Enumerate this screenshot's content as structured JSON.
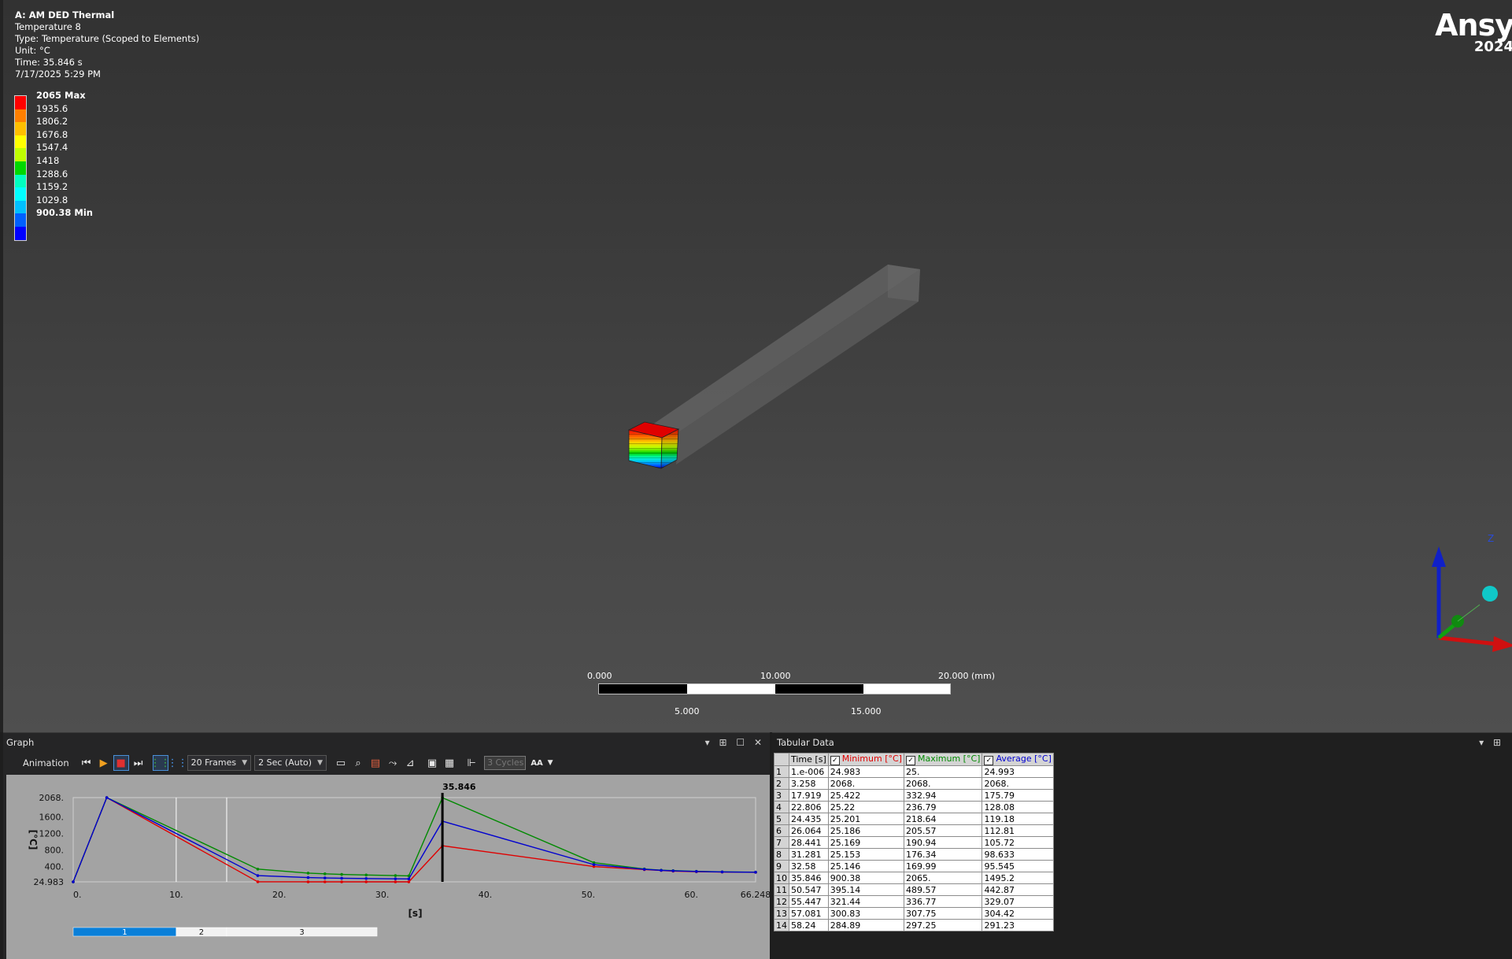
{
  "result": {
    "system": "A: AM DED Thermal",
    "name": "Temperature 8",
    "type": "Type: Temperature (Scoped to Elements)",
    "unit": "Unit: °C",
    "time": "Time: 35.846 s",
    "date": "7/17/2025 5:29 PM"
  },
  "legend": {
    "labels": [
      "2065 Max",
      "1935.6",
      "1806.2",
      "1676.8",
      "1547.4",
      "1418",
      "1288.6",
      "1159.2",
      "1029.8",
      "900.38 Min"
    ],
    "colors": [
      "#ff0000",
      "#ff7f00",
      "#ffbf00",
      "#ffff00",
      "#bfff00",
      "#00d800",
      "#00ffbf",
      "#00ffff",
      "#00bfff",
      "#0060ff",
      "#0000ff"
    ]
  },
  "brand": {
    "name": "Ansy",
    "year": "2024"
  },
  "scale_bar": {
    "top_labels": [
      "0.000",
      "10.000",
      "20.000 (mm)"
    ],
    "bottom_labels": [
      "5.000",
      "15.000"
    ]
  },
  "triad": {
    "z_label": "Z"
  },
  "graph_panel": {
    "title": "Graph",
    "tools": {
      "dropdown": "▾",
      "pin": "⊞",
      "maximize": "☐",
      "close": "✕"
    },
    "animation": {
      "label": "Animation",
      "frames": "20 Frames",
      "duration": "2 Sec (Auto)",
      "cycles": "3 Cycles",
      "aa_label": "AA"
    }
  },
  "chart_data": {
    "type": "line",
    "x": [
      1e-06,
      3.258,
      17.919,
      22.806,
      24.435,
      26.064,
      28.441,
      31.281,
      32.58,
      35.846,
      50.547,
      55.447,
      57.081,
      58.24,
      60.5,
      63.0,
      66.248
    ],
    "series": [
      {
        "name": "Minimum [°C]",
        "color": "#e00000",
        "values": [
          24.983,
          2068,
          25.422,
          25.22,
          25.201,
          25.186,
          25.169,
          25.153,
          25.146,
          900.38,
          395.14,
          321.44,
          300.83,
          284.89,
          270,
          262,
          255
        ]
      },
      {
        "name": "Maximum [°C]",
        "color": "#008a00",
        "values": [
          25,
          2068,
          332.94,
          236.79,
          218.64,
          205.57,
          190.94,
          176.34,
          169.99,
          2065,
          489.57,
          336.77,
          307.75,
          297.25,
          280,
          268,
          260
        ]
      },
      {
        "name": "Average [°C]",
        "color": "#0000d0",
        "values": [
          24.993,
          2068,
          175.79,
          128.08,
          119.18,
          112.81,
          105.72,
          98.633,
          95.545,
          1495.2,
          442.87,
          329.07,
          304.42,
          291.23,
          276,
          265,
          258
        ]
      }
    ],
    "x_ticks": [
      "0.",
      "10.",
      "20.",
      "30.",
      "40.",
      "50.",
      "60.",
      "66.248"
    ],
    "x_tick_values": [
      0,
      10,
      20,
      30,
      40,
      50,
      60,
      66.248
    ],
    "y_ticks": [
      "24.983",
      "400.",
      "800.",
      "1200.",
      "1600.",
      "2068."
    ],
    "y_tick_values": [
      24.983,
      400,
      800,
      1200,
      1600,
      2068
    ],
    "xlabel": "[s]",
    "ylabel": "[°C]",
    "xlim": [
      0,
      66.248
    ],
    "ylim": [
      24.983,
      2068
    ],
    "current_time": 35.846,
    "current_time_label": "35.846",
    "step_markers": [
      10,
      14.9
    ],
    "steps": [
      {
        "label": "1",
        "start": 0,
        "end": 10
      },
      {
        "label": "2",
        "start": 10,
        "end": 14.9
      },
      {
        "label": "3",
        "start": 14.9,
        "end": 29.5
      }
    ]
  },
  "tabular_panel": {
    "title": "Tabular Data",
    "tools": {
      "dropdown": "▾",
      "pin": "⊞"
    },
    "columns": [
      "Time [s]",
      "Minimum [°C]",
      "Maximum [°C]",
      "Average [°C]"
    ],
    "column_colors": [
      "#000000",
      "#e00000",
      "#008a00",
      "#0000d0"
    ],
    "rows": [
      [
        "1",
        "1.e-006",
        "24.983",
        "25.",
        "24.993"
      ],
      [
        "2",
        "3.258",
        "2068.",
        "2068.",
        "2068."
      ],
      [
        "3",
        "17.919",
        "25.422",
        "332.94",
        "175.79"
      ],
      [
        "4",
        "22.806",
        "25.22",
        "236.79",
        "128.08"
      ],
      [
        "5",
        "24.435",
        "25.201",
        "218.64",
        "119.18"
      ],
      [
        "6",
        "26.064",
        "25.186",
        "205.57",
        "112.81"
      ],
      [
        "7",
        "28.441",
        "25.169",
        "190.94",
        "105.72"
      ],
      [
        "8",
        "31.281",
        "25.153",
        "176.34",
        "98.633"
      ],
      [
        "9",
        "32.58",
        "25.146",
        "169.99",
        "95.545"
      ],
      [
        "10",
        "35.846",
        "900.38",
        "2065.",
        "1495.2"
      ],
      [
        "11",
        "50.547",
        "395.14",
        "489.57",
        "442.87"
      ],
      [
        "12",
        "55.447",
        "321.44",
        "336.77",
        "329.07"
      ],
      [
        "13",
        "57.081",
        "300.83",
        "307.75",
        "304.42"
      ],
      [
        "14",
        "58.24",
        "284.89",
        "297.25",
        "291.23"
      ]
    ]
  }
}
